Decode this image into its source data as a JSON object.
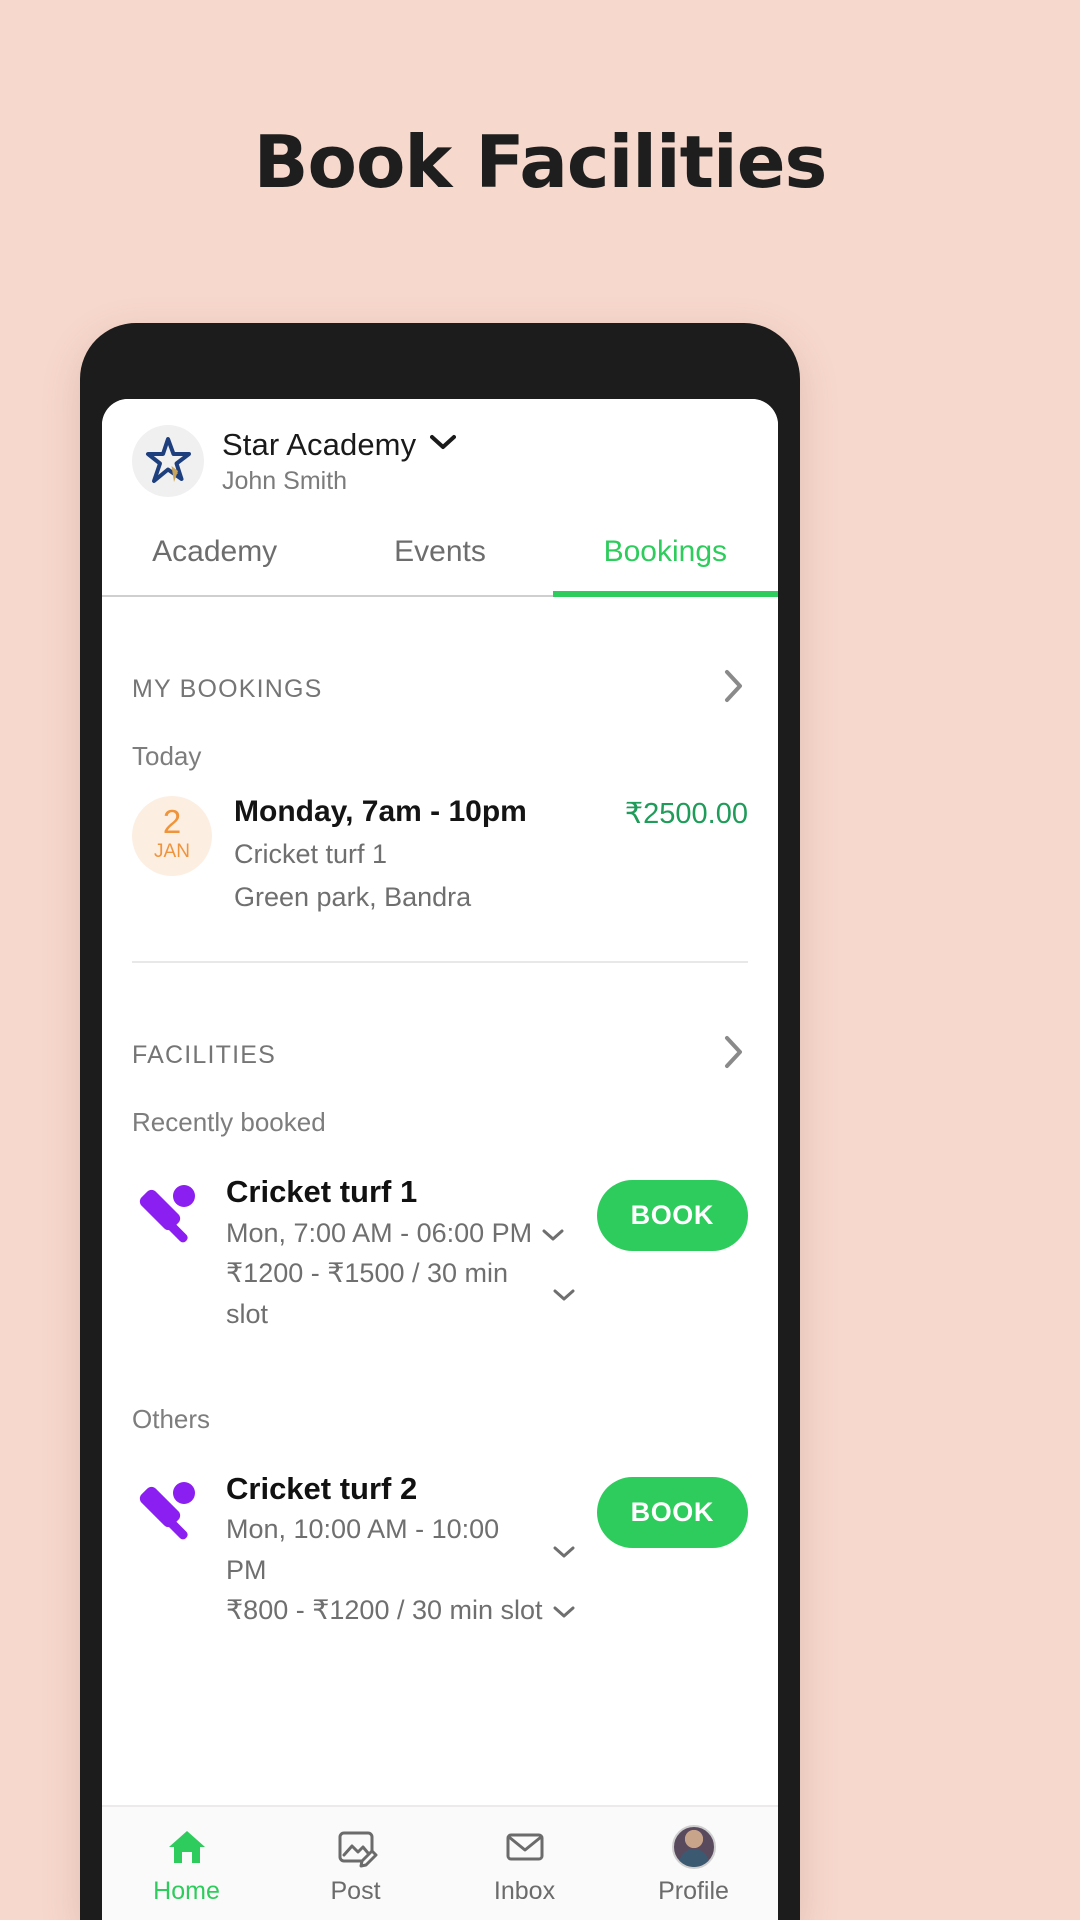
{
  "poster": {
    "title": "Book Facilities",
    "background_color": "#f7d8cd"
  },
  "app_header": {
    "logo_icon": "star-logo-icon",
    "org_name": "Star Academy",
    "org_chevron_icon": "chevron-down-icon",
    "user_name": "John Smith"
  },
  "tabs": {
    "items": [
      {
        "label": "Academy",
        "active": false
      },
      {
        "label": "Events",
        "active": false
      },
      {
        "label": "Bookings",
        "active": true
      }
    ],
    "active_color": "#2ecc5c"
  },
  "my_bookings": {
    "section_title": "MY BOOKINGS",
    "chevron_icon": "chevron-right-icon",
    "group_label": "Today",
    "items": [
      {
        "day": "2",
        "month": "JAN",
        "title": "Monday, 7am - 10pm",
        "facility": "Cricket turf 1",
        "location": "Green park, Bandra",
        "price": "₹2500.00",
        "price_color": "#1f9b5a",
        "badge_color": "#f0943c"
      }
    ]
  },
  "facilities": {
    "section_title": "FACILITIES",
    "chevron_icon": "chevron-right-icon",
    "groups": [
      {
        "label": "Recently booked",
        "items": [
          {
            "icon": "cricket-bat-ball-icon",
            "name": "Cricket turf 1",
            "hours": "Mon, 7:00 AM - 06:00 PM",
            "price": "₹1200 -  ₹1500 / 30 min slot",
            "book_label": "BOOK"
          }
        ]
      },
      {
        "label": "Others",
        "items": [
          {
            "icon": "cricket-bat-ball-icon",
            "name": "Cricket turf 2",
            "hours": "Mon, 10:00 AM - 10:00 PM",
            "price": "₹800 -  ₹1200 / 30 min slot",
            "book_label": "BOOK"
          }
        ]
      }
    ]
  },
  "bottom_nav": {
    "items": [
      {
        "label": "Home",
        "icon": "home-icon",
        "active": true
      },
      {
        "label": "Post",
        "icon": "image-edit-icon",
        "active": false
      },
      {
        "label": "Inbox",
        "icon": "envelope-icon",
        "active": false
      },
      {
        "label": "Profile",
        "icon": "avatar-icon",
        "active": false
      }
    ]
  }
}
